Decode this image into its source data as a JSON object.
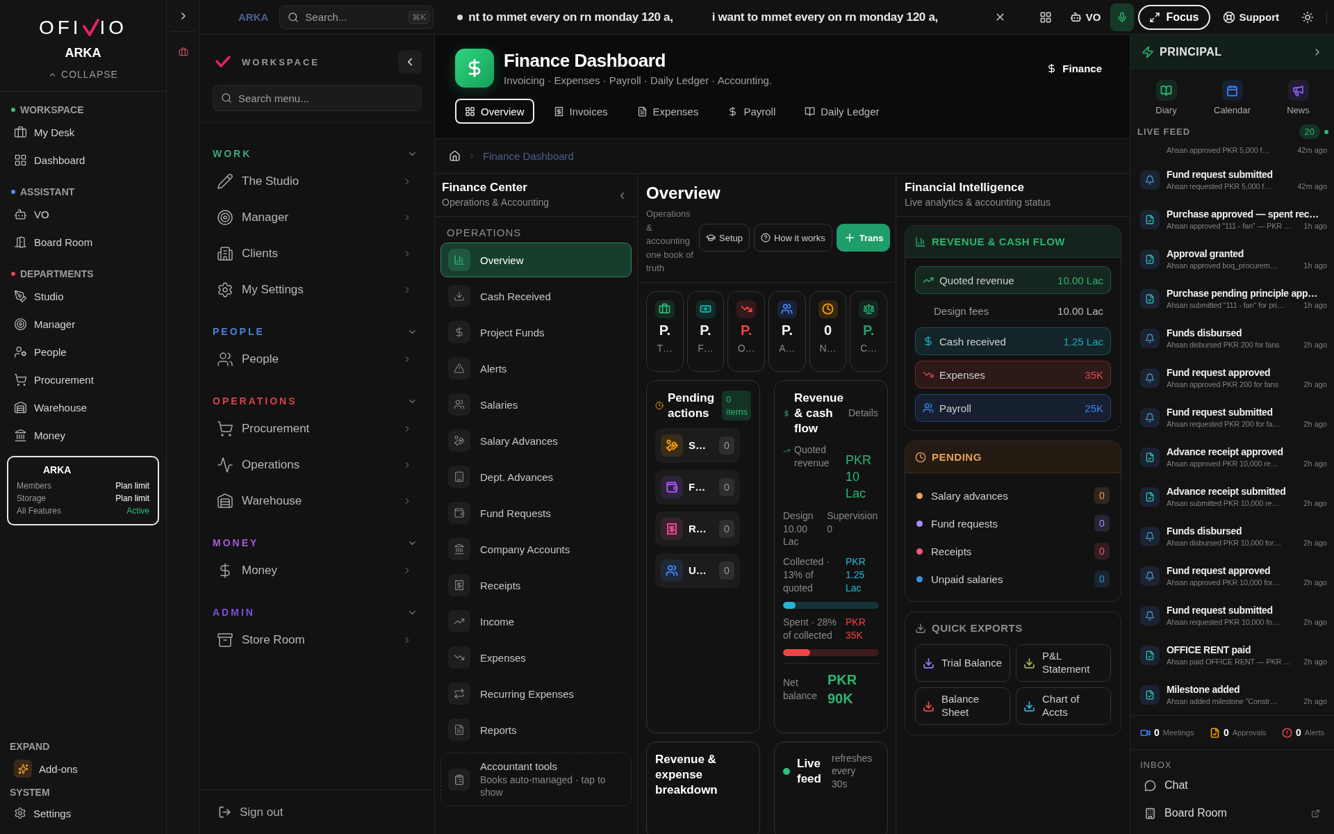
{
  "topbar": {
    "workspace": "ARKA",
    "search": {
      "placeholder": "Search...",
      "shortcut": "⌘K"
    },
    "ticker": [
      "nt to mmet every on rn monday 120 a,",
      "i want to mmet every on rn monday 120 a,"
    ],
    "assistant": "VO",
    "mic_on": true,
    "focus": "Focus",
    "support": "Support"
  },
  "sidebar": {
    "logo": [
      "OFI",
      "IO"
    ],
    "org": "ARKA",
    "collapse": "COLLAPSE",
    "sections": [
      {
        "title": "WORKSPACE",
        "color": "#3fb97a",
        "items": [
          "My Desk",
          "Dashboard"
        ]
      },
      {
        "title": "ASSISTANT",
        "color": "#5b8def",
        "items": [
          "VO",
          "Board Room"
        ]
      },
      {
        "title": "DEPARTMENTS",
        "color": "#e5484d",
        "items": [
          "Studio",
          "Manager",
          "People",
          "Procurement",
          "Warehouse",
          "Money"
        ]
      }
    ],
    "plan": {
      "name": "ARKA",
      "rows": [
        {
          "label": "Members",
          "value": "Plan limit",
          "active": false
        },
        {
          "label": "Storage",
          "value": "Plan limit",
          "active": false
        },
        {
          "label": "All Features",
          "value": "Active",
          "active": true
        }
      ]
    },
    "expand": {
      "title": "EXPAND",
      "items": [
        "Add-ons"
      ]
    },
    "system": {
      "title": "SYSTEM",
      "items": [
        "Settings"
      ]
    }
  },
  "menu": {
    "title": "WORKSPACE",
    "search_placeholder": "Search menu...",
    "groups": [
      {
        "title": "WORK",
        "color": "#3fa877",
        "expanded": true,
        "items": [
          "The Studio",
          "Manager",
          "Clients",
          "My Settings"
        ]
      },
      {
        "title": "PEOPLE",
        "color": "#4f7fd8",
        "expanded": true,
        "items": [
          "People"
        ]
      },
      {
        "title": "OPERATIONS",
        "color": "#d9434a",
        "expanded": true,
        "items": [
          "Procurement",
          "Operations",
          "Warehouse"
        ]
      },
      {
        "title": "MONEY",
        "color": "#a45bd6",
        "expanded": true,
        "items": [
          "Money"
        ]
      },
      {
        "title": "ADMIN",
        "color": "#7c4fe0",
        "expanded": true,
        "items": [
          "Store Room"
        ]
      }
    ],
    "sign_out": "Sign out"
  },
  "header": {
    "title": "Finance Dashboard",
    "subtitle": "Invoicing · Expenses · Payroll · Daily Ledger · Accounting.",
    "module": "Finance",
    "tabs": [
      {
        "label": "Overview",
        "selected": true
      },
      {
        "label": "Invoices",
        "selected": false
      },
      {
        "label": "Expenses",
        "selected": false
      },
      {
        "label": "Payroll",
        "selected": false
      },
      {
        "label": "Daily Ledger",
        "selected": false
      }
    ],
    "breadcrumb": "Finance Dashboard"
  },
  "finance_center": {
    "title": "Finance Center",
    "subtitle": "Operations & Accounting",
    "section": "OPERATIONS",
    "items": [
      {
        "label": "Overview",
        "selected": true
      },
      {
        "label": "Cash Received",
        "selected": false
      },
      {
        "label": "Project Funds",
        "selected": false
      },
      {
        "label": "Alerts",
        "selected": false
      },
      {
        "label": "Salaries",
        "selected": false
      },
      {
        "label": "Salary Advances",
        "selected": false
      },
      {
        "label": "Dept. Advances",
        "selected": false
      },
      {
        "label": "Fund Requests",
        "selected": false
      },
      {
        "label": "Company Accounts",
        "selected": false
      },
      {
        "label": "Receipts",
        "selected": false
      },
      {
        "label": "Income",
        "selected": false
      },
      {
        "label": "Expenses",
        "selected": false
      },
      {
        "label": "Recurring Expenses",
        "selected": false
      },
      {
        "label": "Reports",
        "selected": false
      }
    ],
    "tools": {
      "title": "Accountant tools",
      "note": "Books auto-managed · tap to show"
    }
  },
  "overview": {
    "title": "Overview",
    "subtitle": "Operations & accounting one book of truth",
    "buttons": [
      {
        "label": "Setup",
        "kind": "outline"
      },
      {
        "label": "How it works",
        "kind": "outline"
      },
      {
        "label": "Trans",
        "kind": "primary"
      }
    ],
    "stats": [
      {
        "value": "P.",
        "label": "T…",
        "color": "#2bb673",
        "highlighted": false
      },
      {
        "value": "P.",
        "label": "F…",
        "color": "#14b8a6",
        "highlighted": false
      },
      {
        "value": "P.",
        "label": "O…",
        "color": "#ef4444",
        "highlighted": true
      },
      {
        "value": "P.",
        "label": "A…",
        "color": "#3b82f6",
        "highlighted": false
      },
      {
        "value": "0",
        "label": "N…",
        "color": "#f59e0b",
        "highlighted": false
      },
      {
        "value": "P.",
        "label": "C…",
        "color": "#22a06b",
        "highlighted": true
      }
    ],
    "pending": {
      "title": "Pending actions",
      "badge": "0 items",
      "rows": [
        {
          "label": "S…",
          "count": "0",
          "color": "#f59e0b"
        },
        {
          "label": "F…",
          "count": "0",
          "color": "#a855f7"
        },
        {
          "label": "R…",
          "count": "0",
          "color": "#ec4899"
        },
        {
          "label": "U…",
          "count": "0",
          "color": "#3b82f6"
        }
      ]
    },
    "cashflow": {
      "title": "Revenue & cash flow",
      "link": "Details",
      "quoted": {
        "label": "Quoted revenue",
        "value": "PKR 10 Lac"
      },
      "split": [
        {
          "label": "Design",
          "value": "10.00 Lac"
        },
        {
          "label": "Supervision",
          "value": "0"
        }
      ],
      "meters": [
        {
          "label": "Collected · 13% of quoted",
          "value": "PKR 1.25 Lac",
          "level": 0.13,
          "color": "#22b8d6"
        },
        {
          "label": "Spent · 28% of collected",
          "value": "PKR 35K",
          "level": 0.28,
          "color": "#ef4444"
        }
      ],
      "net": {
        "label": "Net balance",
        "value": "PKR 90K"
      }
    },
    "breakdown": {
      "title": "Revenue & expense breakdown"
    },
    "live": {
      "title": "Live feed",
      "note": "refreshes every 30s"
    }
  },
  "intelligence": {
    "title": "Financial Intelligence",
    "subtitle": "Live analytics & accounting status",
    "revenue": {
      "title": "REVENUE & CASH FLOW",
      "rows": [
        {
          "kind": "highlight",
          "label": "Quoted revenue",
          "value": "10.00 Lac",
          "color": "#2bb673"
        },
        {
          "kind": "plain",
          "label": "Design fees",
          "value": "10.00 Lac"
        },
        {
          "kind": "highlight",
          "label": "Cash received",
          "value": "1.25 Lac",
          "color": "#26a6c4"
        },
        {
          "kind": "highlight",
          "label": "Expenses",
          "value": "35K",
          "color": "#e5484d"
        },
        {
          "kind": "highlight",
          "label": "Payroll",
          "value": "25K",
          "color": "#3b82f6"
        }
      ]
    },
    "pending": {
      "title": "PENDING",
      "rows": [
        {
          "label": "Salary advances",
          "count": "0",
          "color": "#e8a05c"
        },
        {
          "label": "Fund requests",
          "count": "0",
          "color": "#a78bfa"
        },
        {
          "label": "Receipts",
          "count": "0",
          "color": "#ec5b7a"
        },
        {
          "label": "Unpaid salaries",
          "count": "0",
          "color": "#3b8fd9"
        }
      ]
    },
    "exports": {
      "title": "QUICK EXPORTS",
      "items": [
        {
          "label": "Trial Balance",
          "color": "#8b7cf6"
        },
        {
          "label": "P&L Statement",
          "color": "#9bb05a"
        },
        {
          "label": "Balance Sheet",
          "color": "#e5484d"
        },
        {
          "label": "Chart of Accts",
          "color": "#3ba7e0"
        }
      ]
    }
  },
  "principal": {
    "title": "PRINCIPAL",
    "shortcuts": [
      {
        "label": "Diary",
        "color": "#2bb673"
      },
      {
        "label": "Calendar",
        "color": "#3b82f6"
      },
      {
        "label": "News",
        "color": "#8b5cf6"
      }
    ],
    "feed_title": "LIVE FEED",
    "feed_count": "20",
    "feed": [
      {
        "kind": "record",
        "sub": "Ahsan approved PKR 5,000 f…",
        "time": "42m ago"
      },
      {
        "kind": "notice",
        "title": "Fund request submitted",
        "sub": "Ahsan requested PKR 5,000 f…",
        "time": "42m ago"
      },
      {
        "kind": "record",
        "title": "Purchase approved — spent rec…",
        "sub": "Ahsan approved \"111 - fan\" — PKR …",
        "time": "1h ago"
      },
      {
        "kind": "record",
        "title": "Approval granted",
        "sub": "Ahsan approved boq_procurem…",
        "time": "1h ago"
      },
      {
        "kind": "record",
        "title": "Purchase pending principle app…",
        "sub": "Ahsan submitted \"111 - fan\" for pri…",
        "time": "1h ago"
      },
      {
        "kind": "notice",
        "title": "Funds disbursed",
        "sub": "Ahsan disbursed PKR 200 for fans",
        "time": "2h ago"
      },
      {
        "kind": "notice",
        "title": "Fund request approved",
        "sub": "Ahsan approved PKR 200 for fans",
        "time": "2h ago"
      },
      {
        "kind": "notice",
        "title": "Fund request submitted",
        "sub": "Ahsan requested PKR 200 for fa…",
        "time": "2h ago"
      },
      {
        "kind": "record",
        "title": "Advance receipt approved",
        "sub": "Ahsan approved PKR 10,000 re…",
        "time": "2h ago"
      },
      {
        "kind": "record",
        "title": "Advance receipt submitted",
        "sub": "Ahsan submitted PKR 10,000 re…",
        "time": "2h ago"
      },
      {
        "kind": "notice",
        "title": "Funds disbursed",
        "sub": "Ahsan disbursed PKR 10,000 for…",
        "time": "2h ago"
      },
      {
        "kind": "notice",
        "title": "Fund request approved",
        "sub": "Ahsan approved PKR 10,000 for…",
        "time": "2h ago"
      },
      {
        "kind": "notice",
        "title": "Fund request submitted",
        "sub": "Ahsan requested PKR 10,000 fo…",
        "time": "2h ago"
      },
      {
        "kind": "record",
        "title": "OFFICE RENT paid",
        "sub": "Ahsan paid OFFICE RENT — PKR …",
        "time": "2h ago"
      },
      {
        "kind": "record",
        "title": "Milestone added",
        "sub": "Ahsan added milestone \"Constr…",
        "time": "2h ago"
      }
    ],
    "stats": [
      {
        "count": "0",
        "label": "Meetings",
        "color": "#3b82f6"
      },
      {
        "count": "0",
        "label": "Approvals",
        "color": "#f59e0b"
      },
      {
        "count": "0",
        "label": "Alerts",
        "color": "#e5484d"
      }
    ],
    "inbox_title": "INBOX",
    "inbox": [
      {
        "label": "Chat",
        "external": false
      },
      {
        "label": "Board Room",
        "external": true
      }
    ]
  }
}
